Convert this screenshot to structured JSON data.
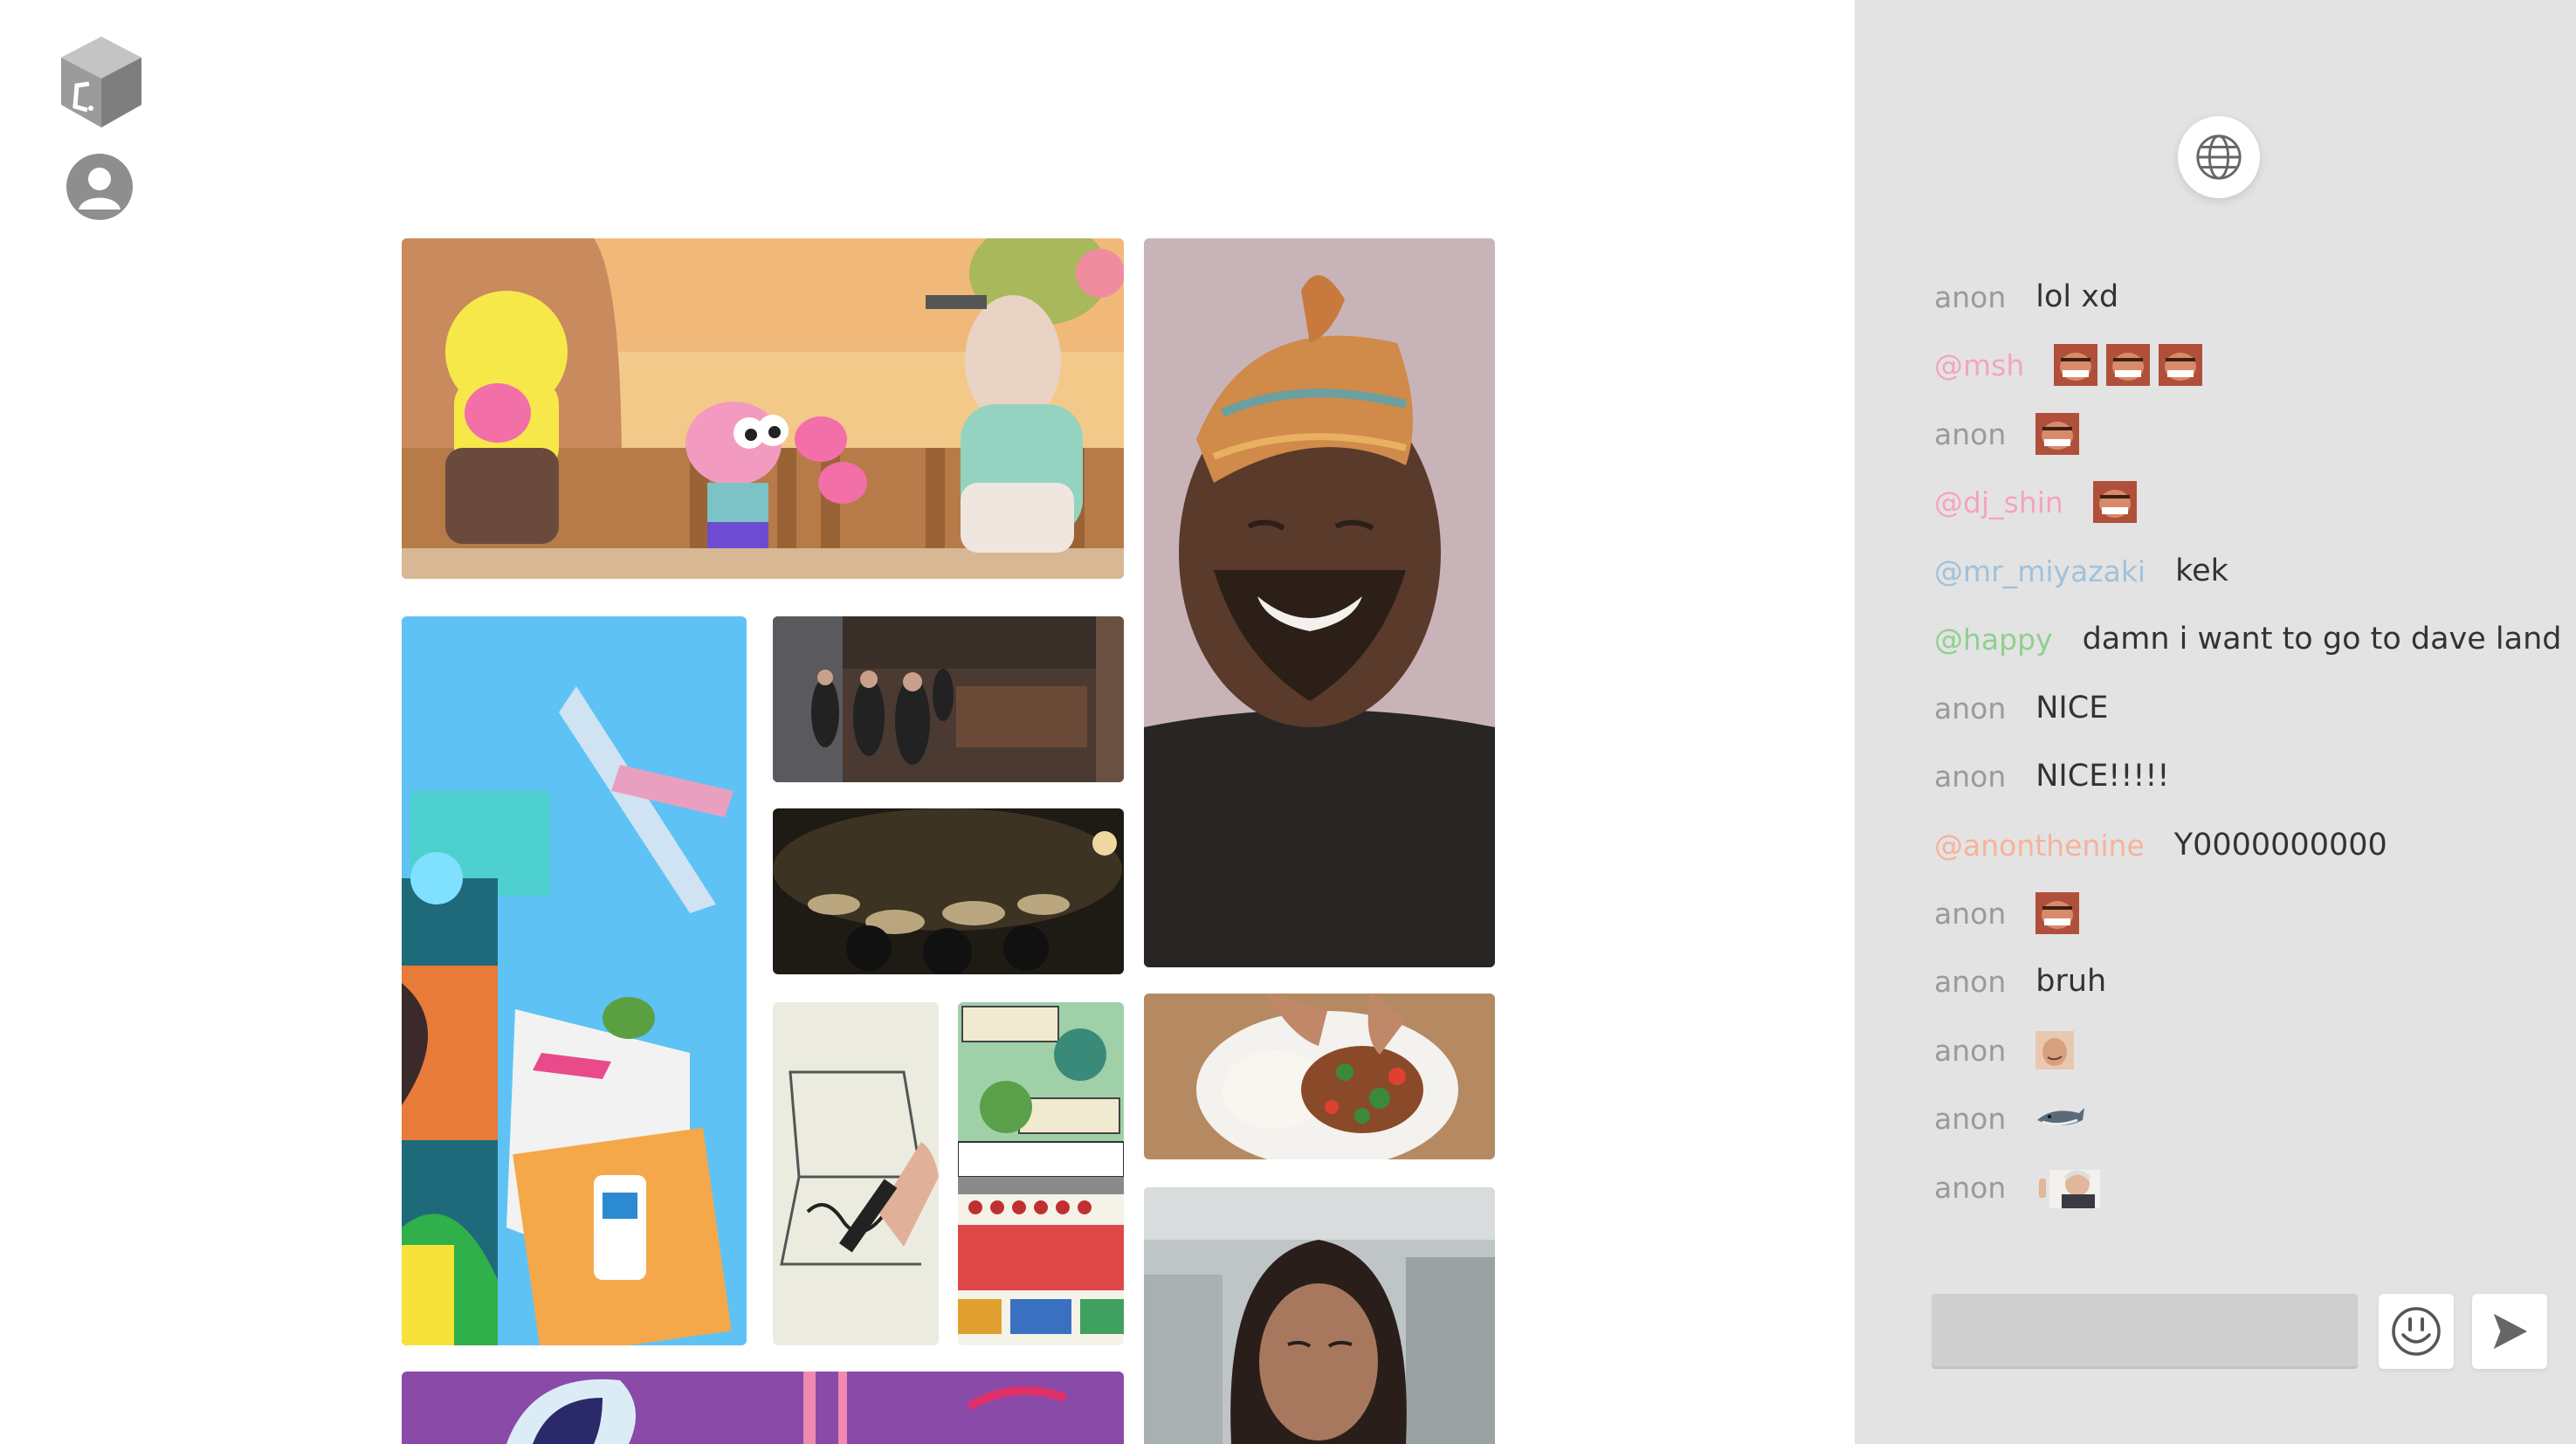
{
  "colors": {
    "anon": "#9a9a9a",
    "msh": "#f5a3c3",
    "dj_shin": "#f5a3c3",
    "mr_miyazaki": "#9fc2dc",
    "happy": "#8fd08f",
    "anonthenine": "#f5b39a"
  },
  "chat": {
    "messages": [
      {
        "user": "anon",
        "color": "anon",
        "text": "lol xd",
        "emotes": []
      },
      {
        "user": "@msh",
        "color": "msh",
        "text": "",
        "emotes": [
          "laughing-face-emote",
          "laughing-face-emote",
          "laughing-face-emote"
        ]
      },
      {
        "user": "anon",
        "color": "anon",
        "text": "",
        "emotes": [
          "laughing-face-emote"
        ]
      },
      {
        "user": "@dj_shin",
        "color": "dj_shin",
        "text": "",
        "emotes": [
          "laughing-face-emote"
        ]
      },
      {
        "user": "@mr_miyazaki",
        "color": "mr_miyazaki",
        "text": "kek",
        "emotes": []
      },
      {
        "user": "@happy",
        "color": "happy",
        "text": "damn i want to go to dave land",
        "emotes": []
      },
      {
        "user": "anon",
        "color": "anon",
        "text": "NICE",
        "emotes": []
      },
      {
        "user": "anon",
        "color": "anon",
        "text": "NICE!!!!!",
        "emotes": []
      },
      {
        "user": "@anonthenine",
        "color": "anonthenine",
        "text": "Y0000000000",
        "emotes": []
      },
      {
        "user": "anon",
        "color": "anon",
        "text": "",
        "emotes": [
          "laughing-face-emote"
        ]
      },
      {
        "user": "anon",
        "color": "anon",
        "text": "bruh",
        "emotes": []
      },
      {
        "user": "anon",
        "color": "anon",
        "text": "",
        "emotes": [
          "smirk-face-emote"
        ]
      },
      {
        "user": "anon",
        "color": "anon",
        "text": "",
        "emotes": [
          "shark-emote"
        ]
      },
      {
        "user": "anon",
        "color": "anon",
        "text": "",
        "emotes": [
          "old-man-wave-emote"
        ]
      }
    ],
    "input_value": "",
    "input_placeholder": ""
  },
  "icons": {
    "logo": "cube-logo-icon",
    "profile": "user-avatar-icon",
    "globe": "globe-icon",
    "emoji": "smiley-icon",
    "send": "send-arrow-icon"
  },
  "feed": {
    "tiles": [
      "cartoon-cotton-candy-thumbnail",
      "laughing-man-headwrap-thumbnail",
      "city-rooftop-illustration-thumbnail",
      "game-scene-crowd-thumbnail",
      "drum-band-concert-thumbnail",
      "pen-sketch-drawing-thumbnail",
      "pokemon-battle-thumbnail",
      "food-plate-thumbnail",
      "woman-portrait-thumbnail",
      "purple-comic-thumbnail"
    ]
  }
}
